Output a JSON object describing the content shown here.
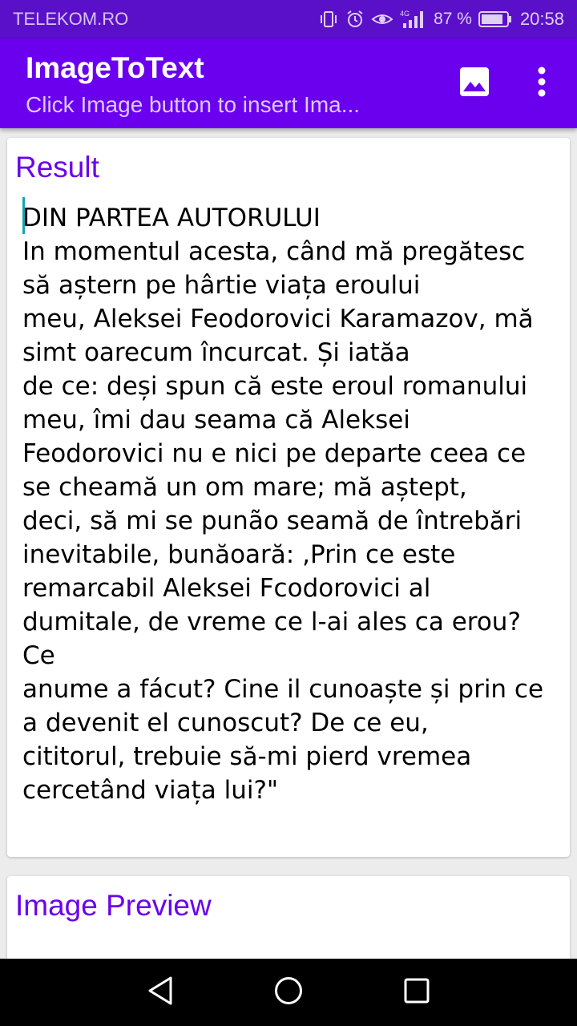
{
  "status_bar": {
    "carrier": "TELEKOM.RO",
    "network_type": "4G",
    "battery_percent": "87 %",
    "time": "20:58",
    "icons": [
      "vibrate-icon",
      "alarm-icon",
      "eye-comfort-icon",
      "signal-icon",
      "battery-icon"
    ]
  },
  "app_bar": {
    "title": "ImageToText",
    "subtitle": "Click Image button  to insert Ima...",
    "background_color": "#6a00ee",
    "actions": [
      "image-icon",
      "overflow-menu-icon"
    ]
  },
  "result_card": {
    "heading": "Result",
    "text": "DIN PARTEA AUTORULUI\nIn momentul acesta, când mă pregătesc\nsă aștern pe hârtie viața eroului\nmeu, Aleksei Feodorovici Karamazov, mă\nsimt oarecum încurcat. Și iatăa\nde ce: deși spun că este eroul romanului\nmeu, îmi dau seama că Aleksei\nFeodorovici nu e nici pe departe ceea ce\nse cheamă un om mare; mă aștept,\ndeci, să mi se punão seamă de întrebări\ninevitabile, bunăoară: ,Prin ce este\nremarcabil Aleksei Fcodorovici al\ndumitale, de vreme ce l-ai ales ca erou?\nCe\nanume a fácut? Cine il cunoaște și prin ce\na devenit el cunoscut? De ce eu,\ncititorul, trebuie să-mi pierd vremea\ncercetând viața lui?\""
  },
  "preview_card": {
    "heading": "Image Preview"
  },
  "nav_bar": {
    "buttons": [
      "back-icon",
      "home-icon",
      "recents-icon"
    ]
  },
  "colors": {
    "accent": "#6a00ee",
    "status_bar": "#5a10c8",
    "cursor": "#17a6b0"
  }
}
